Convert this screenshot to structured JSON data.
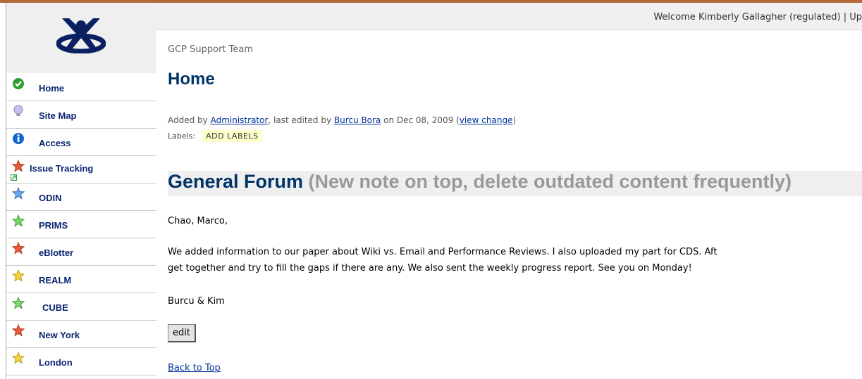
{
  "header": {
    "welcome_text": "Welcome Kimberly Gallagher (regulated) | Up"
  },
  "sidebar": {
    "logo_icon": "confluence-x-logo",
    "items": [
      {
        "label": "Home",
        "icon": "green-check-icon",
        "color": "#33aa33"
      },
      {
        "label": "Site Map",
        "icon": "lightbulb-icon",
        "color": "#b0a8e0"
      },
      {
        "label": "Access",
        "icon": "info-icon",
        "color": "#1166cc"
      },
      {
        "label": "Issue Tracking",
        "icon": "red-star-icon",
        "color": "#e85a3a"
      },
      {
        "label": "ODIN",
        "icon": "blue-star-icon",
        "color": "#5a9ae0"
      },
      {
        "label": "PRIMS",
        "icon": "green-star-icon",
        "color": "#66cc55"
      },
      {
        "label": "eBlotter",
        "icon": "red-star-icon",
        "color": "#e85a3a"
      },
      {
        "label": "REALM",
        "icon": "yellow-star-icon",
        "color": "#f0c830"
      },
      {
        "label": "CUBE",
        "icon": "green-star-icon",
        "color": "#66cc55"
      },
      {
        "label": "New York",
        "icon": "red-star-icon",
        "color": "#e85a3a"
      },
      {
        "label": "London",
        "icon": "yellow-star-icon",
        "color": "#f0c830"
      }
    ]
  },
  "main": {
    "space_name": "GCP Support Team",
    "page_title": "Home",
    "meta": {
      "added_by_prefix": "Added by ",
      "added_by": "Administrator",
      "edited_by_prefix": ", last edited by ",
      "edited_by": "Burcu Bora",
      "date_text": " on Dec 08, 2009  (",
      "view_change": "view change",
      "close_paren": ")"
    },
    "labels_label": "Labels:",
    "add_labels": "ADD LABELS",
    "forum_title": "General Forum",
    "forum_note": " (New note on top, delete outdated content frequently)",
    "greeting": "Chao, Marco,",
    "body_line1": "We added information to our paper about Wiki vs. Email and Performance Reviews. I also uploaded my part for CDS. Aft",
    "body_line2": "get together and try to fill the gaps if there are any. We also sent the weekly progress report. See you on Monday!",
    "signature": "Burcu & Kim",
    "edit_button": "edit",
    "back_to_top": "Back to Top"
  }
}
